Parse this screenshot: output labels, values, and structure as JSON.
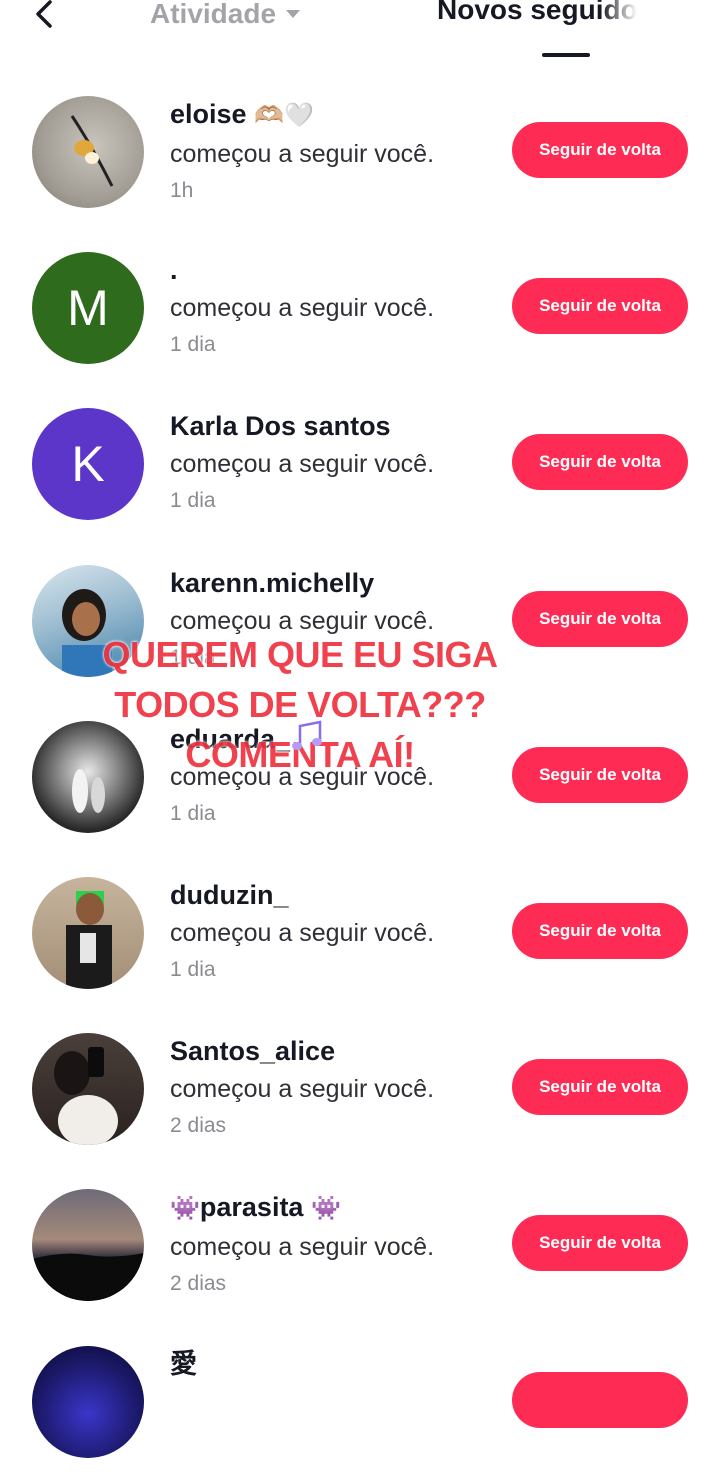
{
  "header": {
    "back_label": "<",
    "tab_activity": "Atividade",
    "tab_new_followers": "Novos seguidores"
  },
  "overlay": {
    "lines": [
      "QUEREM QUE EU SIGA",
      "TODOS DE VOLTA???",
      "COMENTA AÍ!"
    ]
  },
  "followers": [
    {
      "name": "eloise",
      "emoji": "🫶🏼🤍",
      "action": "começou a seguir você.",
      "time": "1h",
      "button": "Seguir de volta",
      "avatar_letter": "",
      "avatar_color": "#9e9a92"
    },
    {
      "name": ".",
      "emoji": "",
      "action": "começou a seguir você.",
      "time": "1 dia",
      "button": "Seguir de volta",
      "avatar_letter": "M",
      "avatar_color": "#2f6b1c"
    },
    {
      "name": "Karla Dos santos",
      "emoji": "",
      "action": "começou a seguir você.",
      "time": "1 dia",
      "button": "Seguir de volta",
      "avatar_letter": "K",
      "avatar_color": "#5c35c9"
    },
    {
      "name": "karenn.michelly",
      "emoji": "",
      "action": "começou a seguir você.",
      "time": "1 dia",
      "button": "Seguir de volta",
      "avatar_letter": "",
      "avatar_color": "#3f7fa8"
    },
    {
      "name": "eduarda_",
      "emoji": "",
      "action": "começou a seguir você.",
      "time": "1 dia",
      "button": "Seguir de volta",
      "avatar_letter": "",
      "avatar_color": "#2a2a2a"
    },
    {
      "name": "duduzin_",
      "emoji": "",
      "action": "começou a seguir você.",
      "time": "1 dia",
      "button": "Seguir de volta",
      "avatar_letter": "",
      "avatar_color": "#8a7a66"
    },
    {
      "name": "Santos_alice",
      "emoji": "",
      "action": "começou a seguir você.",
      "time": "2 dias",
      "button": "Seguir de volta",
      "avatar_letter": "",
      "avatar_color": "#3b3330"
    },
    {
      "name": "parasita",
      "emoji_before": "👾",
      "emoji": "👾",
      "action": "começou a seguir você.",
      "time": "2 dias",
      "button": "Seguir de volta",
      "avatar_letter": "",
      "avatar_color": "#3a3540"
    },
    {
      "name": "愛",
      "emoji": "",
      "action": "",
      "time": "",
      "button": "",
      "avatar_letter": "",
      "avatar_color": "#1d1a6e"
    }
  ]
}
